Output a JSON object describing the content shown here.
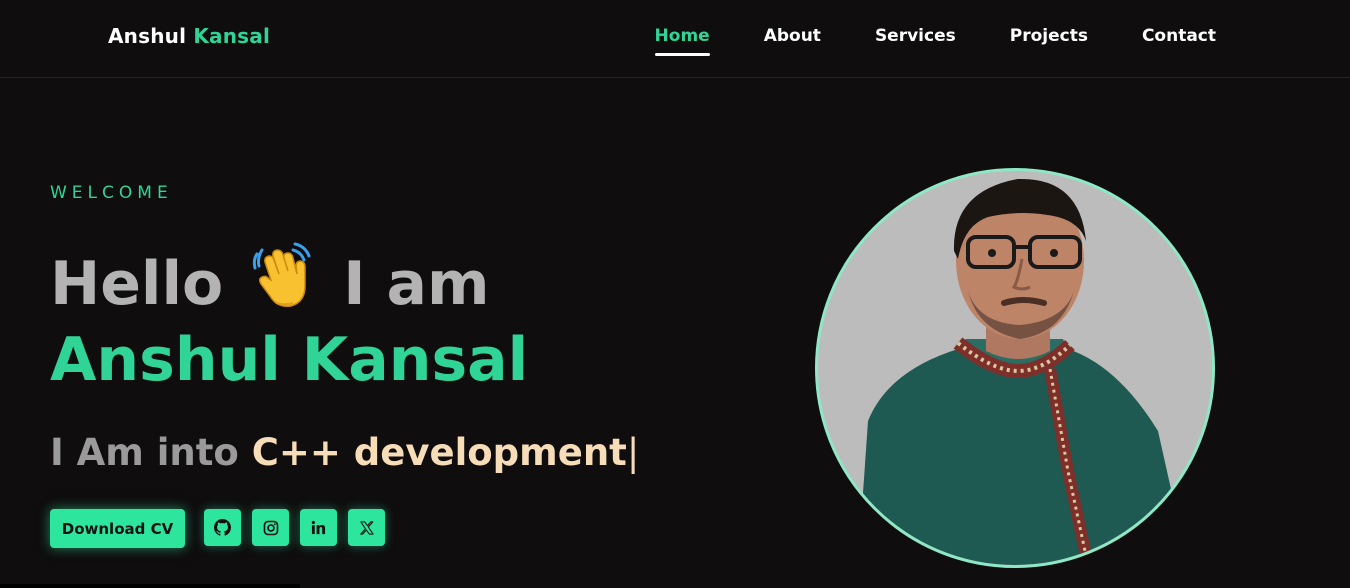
{
  "header": {
    "logo_first": "Anshul",
    "logo_last": "Kansal",
    "nav": [
      {
        "label": "Home",
        "active": true
      },
      {
        "label": "About",
        "active": false
      },
      {
        "label": "Services",
        "active": false
      },
      {
        "label": "Projects",
        "active": false
      },
      {
        "label": "Contact",
        "active": false
      }
    ]
  },
  "hero": {
    "welcome": "WELCOME",
    "hello": "Hello",
    "hand_emoji": "👋",
    "i_am": "I am",
    "name": "Anshul Kansal",
    "into_prefix": "I Am into",
    "into_skill": "C++ development",
    "cursor": "|",
    "download_cv": "Download CV",
    "socials": [
      {
        "icon": "github-icon"
      },
      {
        "icon": "instagram-icon"
      },
      {
        "icon": "linkedin-icon"
      },
      {
        "icon": "x-icon"
      }
    ]
  },
  "colors": {
    "accent": "#2fd496",
    "button": "#2ee59d",
    "background": "#0f0d0e",
    "skill_text": "#f7dcb8",
    "muted": "#b3b3b3"
  }
}
